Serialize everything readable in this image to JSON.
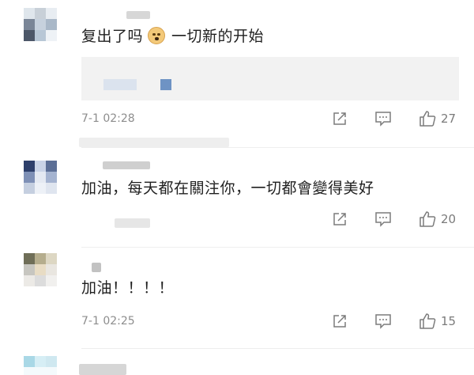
{
  "comments": [
    {
      "text_before": "复出了吗",
      "emoji": "doge-emoji",
      "text_after": "一切新的开始",
      "time": "7-1 02:28",
      "likes": "27",
      "avatar_colors": [
        "#dfe6ec",
        "#c8d0d8",
        "#e8edf2",
        "#7a8697",
        "#c6d1dd",
        "#a9b8c8",
        "#4c5768",
        "#b8c7d6",
        "#eef2f6"
      ],
      "has_reply_preview": true,
      "name_blur_colors": [
        "#d0d0d0",
        "#e5e5e5"
      ]
    },
    {
      "text": "加油，每天都在關注你，一切都會變得美好",
      "time": "",
      "likes": "20",
      "avatar_colors": [
        "#2d3f6b",
        "#c9d3e6",
        "#5c6f96",
        "#7e90b6",
        "#e4e9f2",
        "#a4b3d0",
        "#c5cfe0",
        "#edf1f7",
        "#dfe5ef"
      ],
      "name_blur_colors": [
        "#b8b8b8",
        "#d8d8d8"
      ]
    },
    {
      "text": "加油！！！！",
      "time": "7-1 02:25",
      "likes": "15",
      "avatar_colors": [
        "#6f6e58",
        "#b5ad8d",
        "#ddd7c3",
        "#c7c6c0",
        "#e8dcc4",
        "#e9e6e0",
        "#eceae6",
        "#dcdcdc",
        "#f1f0ee"
      ],
      "name_blur_colors": [
        "#c0c0c0",
        "#e2e2e2"
      ]
    },
    {
      "avatar_colors": [
        "#a9d8e6",
        "#d6eef5",
        "#cfe8f0",
        "#f4fafc",
        "#f4fafc",
        "#f4fafc",
        "#f4fafc",
        "#f4fafc",
        "#f4fafc"
      ],
      "name_blur_colors": [
        "#d0d0d0",
        "#e6e6e6"
      ]
    }
  ],
  "icons": {
    "share": "share-icon",
    "comment": "comment-icon",
    "like": "like-icon"
  },
  "colors": {
    "icon": "#7b7b7b",
    "time": "#8d8d8d",
    "reply_box": "#f2f2f2",
    "reply_blue": "#6e93c4"
  }
}
